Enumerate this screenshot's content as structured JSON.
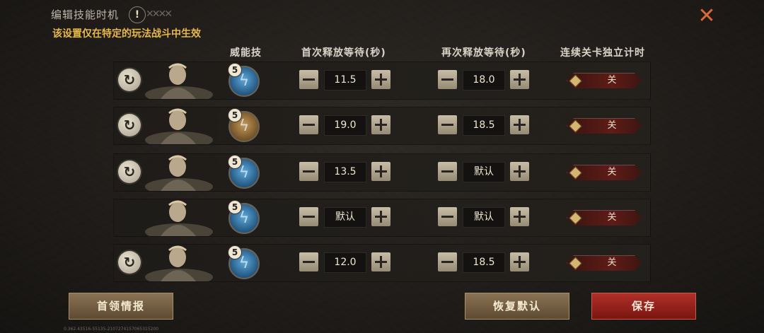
{
  "header": {
    "title": "编辑技能时机",
    "warning_glyph": "!",
    "subtitle": "该设置仅在特定的玩法战斗中生效",
    "close_glyph": "✕"
  },
  "columns": {
    "skill": "威能技",
    "first_wait": "首次释放等待(秒)",
    "repeat_wait": "再次释放等待(秒)",
    "independent_timer": "连续关卡独立计时"
  },
  "rows": [
    {
      "has_swap": true,
      "skill_level": "5",
      "skill_color": "blue",
      "first_wait": "11.5",
      "repeat_wait": "18.0",
      "toggle": "关"
    },
    {
      "has_swap": true,
      "skill_level": "5",
      "skill_color": "gold",
      "first_wait": "19.0",
      "repeat_wait": "18.5",
      "toggle": "关"
    },
    {
      "has_swap": true,
      "skill_level": "5",
      "skill_color": "blue",
      "first_wait": "13.5",
      "repeat_wait": "默认",
      "toggle": "关"
    },
    {
      "has_swap": false,
      "skill_level": "5",
      "skill_color": "blue",
      "first_wait": "默认",
      "repeat_wait": "默认",
      "toggle": "关"
    },
    {
      "has_swap": true,
      "skill_level": "5",
      "skill_color": "blue",
      "first_wait": "12.0",
      "repeat_wait": "18.5",
      "toggle": "关"
    }
  ],
  "buttons": {
    "boss_info": "首领情报",
    "restore_default": "恢复默认",
    "save": "保存"
  },
  "footer": "0.362.43516-55135-2107274157065315200",
  "colors": {
    "accent_gold": "#e7b74a",
    "close_orange": "#d8693a",
    "save_red": "#b03028"
  }
}
